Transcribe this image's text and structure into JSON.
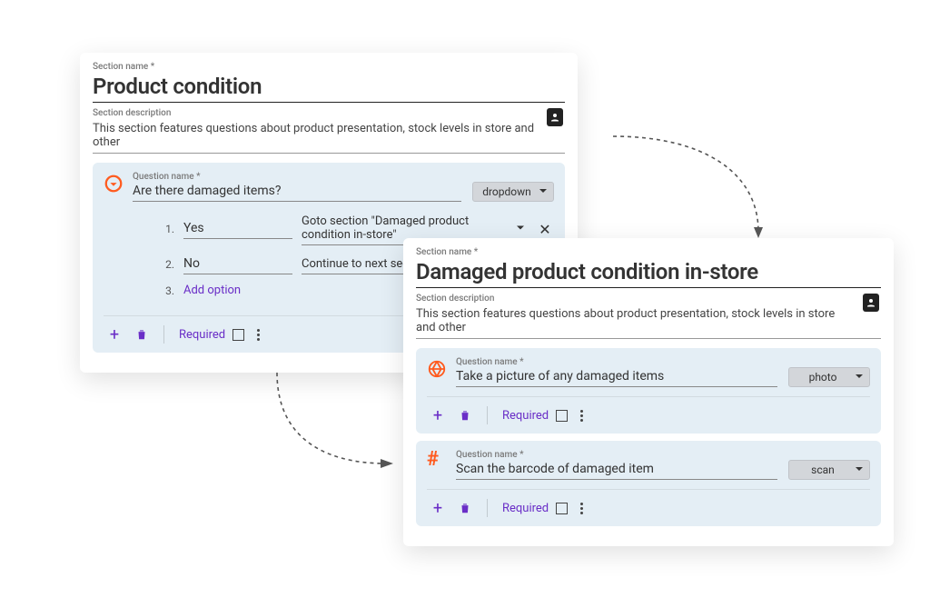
{
  "labels": {
    "section_name": "Section name *",
    "section_description": "Section description",
    "question_name": "Question name *",
    "required": "Required",
    "add_option": "Add option"
  },
  "panelA": {
    "title": "Product condition",
    "description": "This section features questions about product presentation, stock levels in store and other",
    "question": {
      "name": "Are there damaged items?",
      "type": "dropdown",
      "options": [
        {
          "num": "1.",
          "label": "Yes",
          "action": "Goto section \"Damaged product condition in-store\""
        },
        {
          "num": "2.",
          "label": "No",
          "action": "Continue to next section"
        }
      ],
      "add_num": "3."
    }
  },
  "panelB": {
    "title": "Damaged product condition in-store",
    "description": "This section features questions about product presentation, stock levels in store and other",
    "questions": [
      {
        "name": "Take a picture of any damaged items",
        "type": "photo"
      },
      {
        "name": "Scan the barcode of damaged item",
        "type": "scan"
      }
    ]
  }
}
